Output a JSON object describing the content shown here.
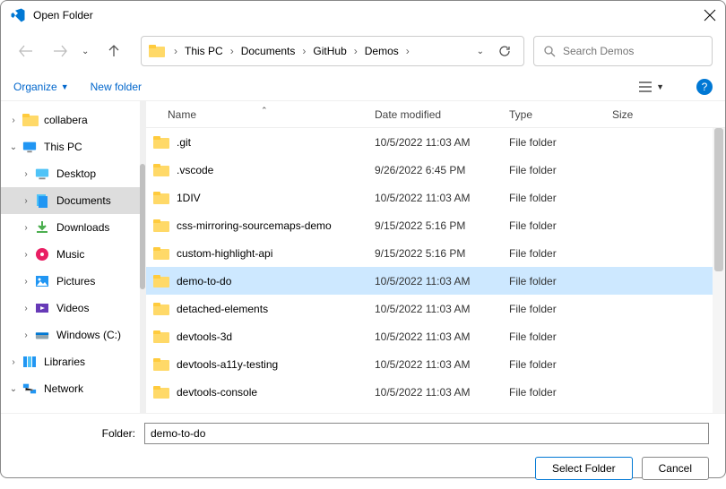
{
  "title": "Open Folder",
  "breadcrumb": [
    "This PC",
    "Documents",
    "GitHub",
    "Demos"
  ],
  "search_placeholder": "Search Demos",
  "toolbar": {
    "organize": "Organize",
    "new_folder": "New folder"
  },
  "columns": {
    "name": "Name",
    "date": "Date modified",
    "type": "Type",
    "size": "Size"
  },
  "tree": [
    {
      "label": "collabera",
      "icon": "folder",
      "depth": 0,
      "expander": "›"
    },
    {
      "label": "This PC",
      "icon": "pc",
      "depth": 0,
      "expander": "⌄"
    },
    {
      "label": "Desktop",
      "icon": "desktop",
      "depth": 1,
      "expander": "›"
    },
    {
      "label": "Documents",
      "icon": "documents",
      "depth": 1,
      "expander": "›",
      "selected": true
    },
    {
      "label": "Downloads",
      "icon": "downloads",
      "depth": 1,
      "expander": "›"
    },
    {
      "label": "Music",
      "icon": "music",
      "depth": 1,
      "expander": "›"
    },
    {
      "label": "Pictures",
      "icon": "pictures",
      "depth": 1,
      "expander": "›"
    },
    {
      "label": "Videos",
      "icon": "videos",
      "depth": 1,
      "expander": "›"
    },
    {
      "label": "Windows (C:)",
      "icon": "drive",
      "depth": 1,
      "expander": "›"
    },
    {
      "label": "Libraries",
      "icon": "libraries",
      "depth": 0,
      "expander": "›"
    },
    {
      "label": "Network",
      "icon": "network",
      "depth": 0,
      "expander": "⌄"
    }
  ],
  "files": [
    {
      "name": ".git",
      "date": "10/5/2022 11:03 AM",
      "type": "File folder"
    },
    {
      "name": ".vscode",
      "date": "9/26/2022 6:45 PM",
      "type": "File folder"
    },
    {
      "name": "1DIV",
      "date": "10/5/2022 11:03 AM",
      "type": "File folder"
    },
    {
      "name": "css-mirroring-sourcemaps-demo",
      "date": "9/15/2022 5:16 PM",
      "type": "File folder"
    },
    {
      "name": "custom-highlight-api",
      "date": "9/15/2022 5:16 PM",
      "type": "File folder"
    },
    {
      "name": "demo-to-do",
      "date": "10/5/2022 11:03 AM",
      "type": "File folder",
      "selected": true
    },
    {
      "name": "detached-elements",
      "date": "10/5/2022 11:03 AM",
      "type": "File folder"
    },
    {
      "name": "devtools-3d",
      "date": "10/5/2022 11:03 AM",
      "type": "File folder"
    },
    {
      "name": "devtools-a11y-testing",
      "date": "10/5/2022 11:03 AM",
      "type": "File folder"
    },
    {
      "name": "devtools-console",
      "date": "10/5/2022 11:03 AM",
      "type": "File folder"
    }
  ],
  "folder_label": "Folder:",
  "folder_value": "demo-to-do",
  "buttons": {
    "select": "Select Folder",
    "cancel": "Cancel"
  }
}
